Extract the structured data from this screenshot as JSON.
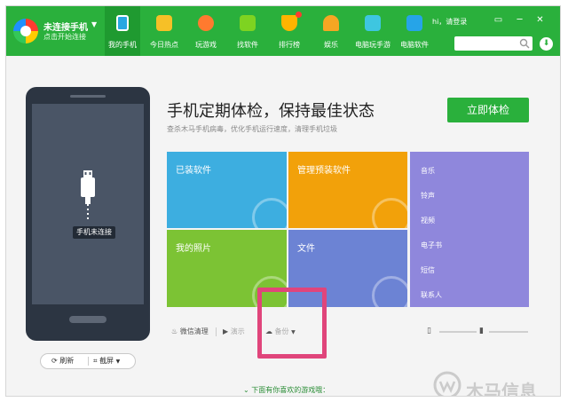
{
  "window": {
    "greeting": "hi，请登录",
    "controls": [
      "▭",
      "─",
      "✕"
    ]
  },
  "brand": {
    "title": "未连接手机",
    "subtitle": "点击开始连接"
  },
  "nav": {
    "items": [
      {
        "label": "我的手机",
        "color": "#29a7e1"
      },
      {
        "label": "今日热点",
        "color": "#f6c027"
      },
      {
        "label": "玩游戏",
        "color": "#ff7a2f"
      },
      {
        "label": "找软件",
        "color": "#7ed321"
      },
      {
        "label": "排行榜",
        "color": "#ffb400"
      },
      {
        "label": "娱乐",
        "color": "#f5a623"
      },
      {
        "label": "电脑玩手游",
        "color": "#3ec6e0"
      },
      {
        "label": "电脑软件",
        "color": "#26a4e8"
      }
    ]
  },
  "search": {
    "placeholder": ""
  },
  "phone": {
    "status": "手机未连接",
    "refresh_label": "刷新",
    "screenshot_label": "截屏"
  },
  "main": {
    "headline": "手机定期体检，保持最佳状态",
    "subline": "查杀木马手机病毒，优化手机运行速度，清理手机垃圾",
    "check_button": "立即体检"
  },
  "tiles": {
    "installed": "已装软件",
    "preinstalled": "管理预装软件",
    "photos": "我的照片",
    "files": "文件"
  },
  "side_list": [
    "音乐",
    "铃声",
    "视频",
    "电子书",
    "短信",
    "联系人"
  ],
  "toolbar": {
    "wechat": "微信清理",
    "demo": "演示",
    "backup": "备份"
  },
  "footer": {
    "more_games": "下面有你喜欢的游戏哦："
  },
  "watermark": {
    "text": "木马信息"
  }
}
